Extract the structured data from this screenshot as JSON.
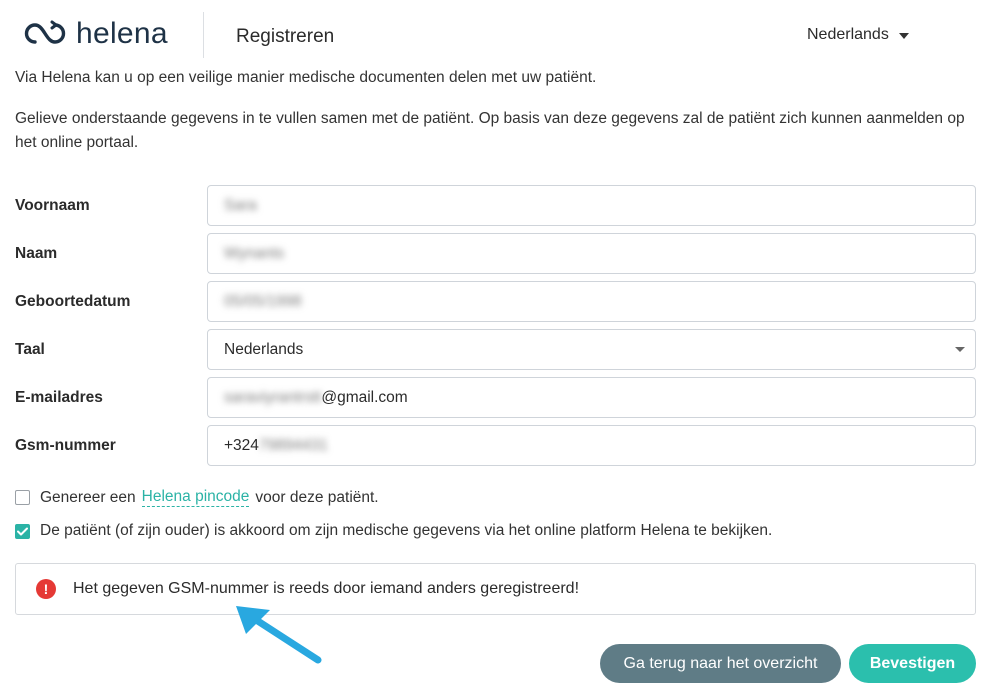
{
  "header": {
    "logo_text": "helena",
    "title": "Registreren",
    "language": "Nederlands"
  },
  "intro": {
    "line1": "Via Helena kan u op een veilige manier medische documenten delen met uw patiënt.",
    "line2": "Gelieve onderstaande gegevens in te vullen samen met de patiënt. Op basis van deze gegevens zal de patiënt zich kunnen aanmelden op het online portaal."
  },
  "form": {
    "first_name": {
      "label": "Voornaam",
      "value": "Sara"
    },
    "last_name": {
      "label": "Naam",
      "value": "Wynants"
    },
    "birthdate": {
      "label": "Geboortedatum",
      "value": "05/05/1998"
    },
    "language": {
      "label": "Taal",
      "value": "Nederlands"
    },
    "email": {
      "label": "E-mailadres",
      "value_hidden": "saraviyrantrstt",
      "value_visible": "@gmail.com"
    },
    "phone": {
      "label": "Gsm-nummer",
      "value_visible": "+324",
      "value_hidden": "79894431"
    }
  },
  "checks": {
    "pincode": {
      "checked": false,
      "before": "Genereer een",
      "link": "Helena pincode",
      "after": "voor deze patiënt."
    },
    "consent": {
      "checked": true,
      "text": "De patiënt (of zijn ouder) is akkoord om zijn medische gegevens via het online platform Helena te bekijken."
    }
  },
  "alert": {
    "icon": "exclamation-icon",
    "text": "Het gegeven GSM-nummer is reeds door iemand anders geregistreerd!"
  },
  "buttons": {
    "back": "Ga terug naar het overzicht",
    "confirm": "Bevestigen"
  },
  "colors": {
    "accent": "#2bbfad",
    "error": "#e53935",
    "secondary_button": "#5f7c86",
    "arrow": "#29a8e0"
  }
}
